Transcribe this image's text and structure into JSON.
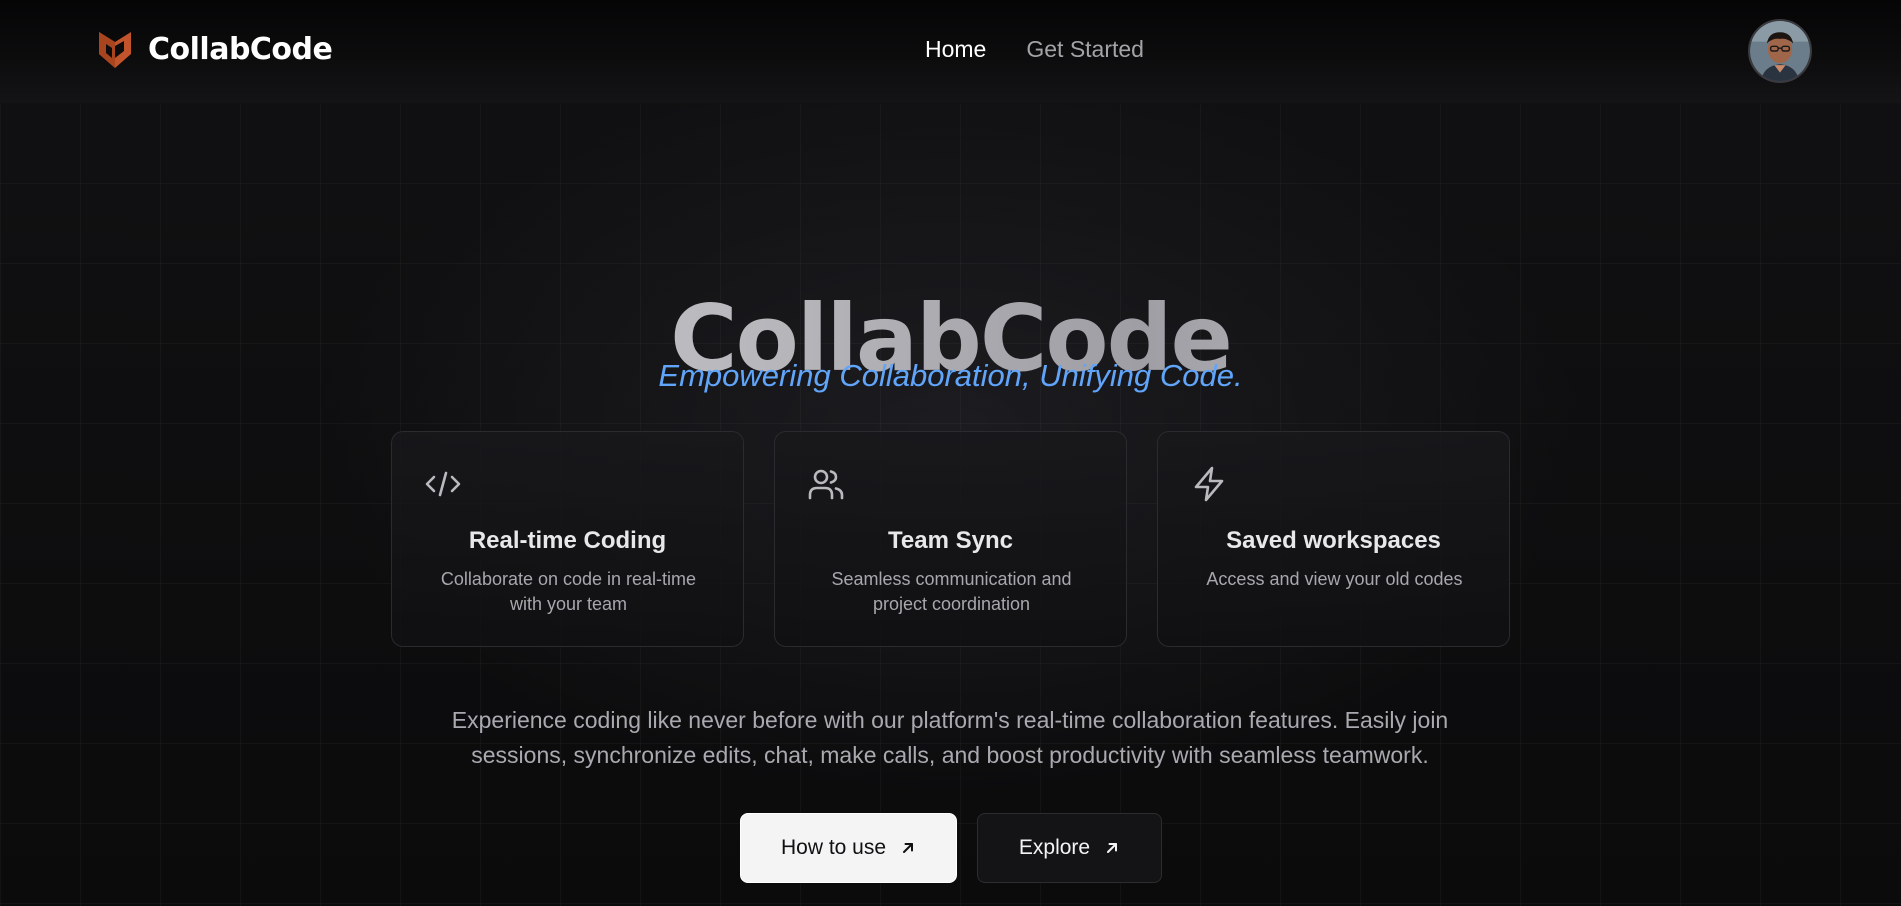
{
  "brand": {
    "name": "CollabCode",
    "logo_icon": "collabcode-logo-icon",
    "logo_color": "#c2542b"
  },
  "nav": {
    "links": [
      {
        "label": "Home",
        "active": true
      },
      {
        "label": "Get Started",
        "active": false
      }
    ]
  },
  "user": {
    "avatar_icon": "user-avatar"
  },
  "hero": {
    "title": "CollabCode",
    "tagline": "Empowering Collaboration, Unifying Code.",
    "tagline_color": "#60a5fa"
  },
  "features": [
    {
      "icon": "code-icon",
      "title": "Real-time Coding",
      "description": "Collaborate on code in real-time with your team"
    },
    {
      "icon": "users-icon",
      "title": "Team Sync",
      "description": "Seamless communication and project coordination"
    },
    {
      "icon": "lightning-icon",
      "title": "Saved workspaces",
      "description": "Access and view your old codes"
    }
  ],
  "description": "Experience coding like never before with our platform's real-time collaboration features. Easily join sessions, synchronize edits, chat, make calls, and boost productivity with seamless teamwork.",
  "cta": {
    "primary_label": "How to use",
    "secondary_label": "Explore",
    "arrow_icon": "arrow-up-right-icon"
  }
}
